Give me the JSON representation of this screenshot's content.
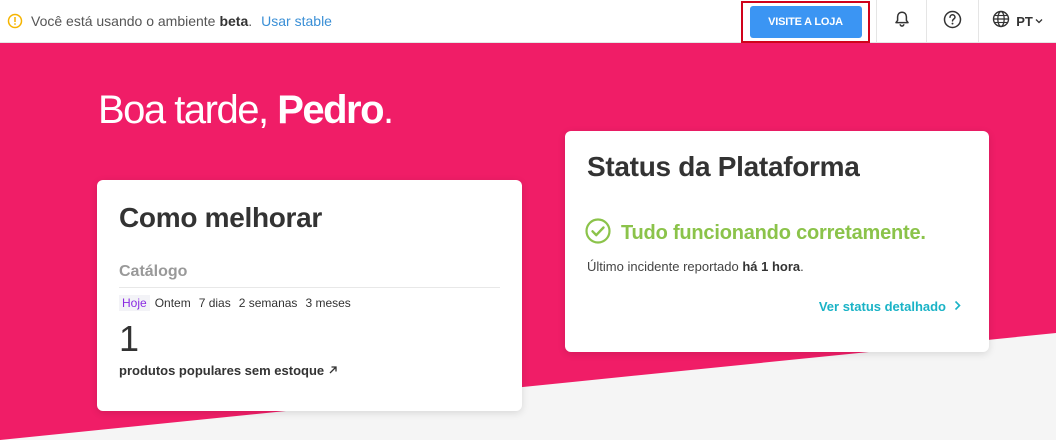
{
  "topbar": {
    "beta_message": "Você está usando o ambiente",
    "beta_word": "beta",
    "use_stable": "Usar stable",
    "visit_store": "VISITE A LOJA",
    "language": "PT"
  },
  "colors": {
    "hero_pink": "#f01d67",
    "primary_blue": "#3b95f3",
    "success_green": "#8bc34a",
    "link_teal": "#1ab3c6",
    "warning_yellow": "#f5b400",
    "highlight_red": "#d0021b"
  },
  "icons": {
    "beta": "warning-circle-icon",
    "notifications": "bell-icon",
    "help": "question-circle-icon",
    "language": "globe-icon",
    "status_ok": "check-circle-icon"
  },
  "greeting": {
    "prefix": "Boa tarde, ",
    "name": "Pedro",
    "suffix": "."
  },
  "improve_card": {
    "title": "Como melhorar",
    "section": "Catálogo",
    "periods": [
      "Hoje",
      "Ontem",
      "7 dias",
      "2 semanas",
      "3 meses"
    ],
    "active_period": "Hoje",
    "value": "1",
    "metric_label": "produtos populares sem estoque"
  },
  "status_card": {
    "title": "Status da Plataforma",
    "status_text": "Tudo funcionando corretamente.",
    "last_incident_prefix": "Último incidente reportado ",
    "last_incident_time": "há 1 hora",
    "last_incident_suffix": ".",
    "detail_link": "Ver status detalhado"
  }
}
